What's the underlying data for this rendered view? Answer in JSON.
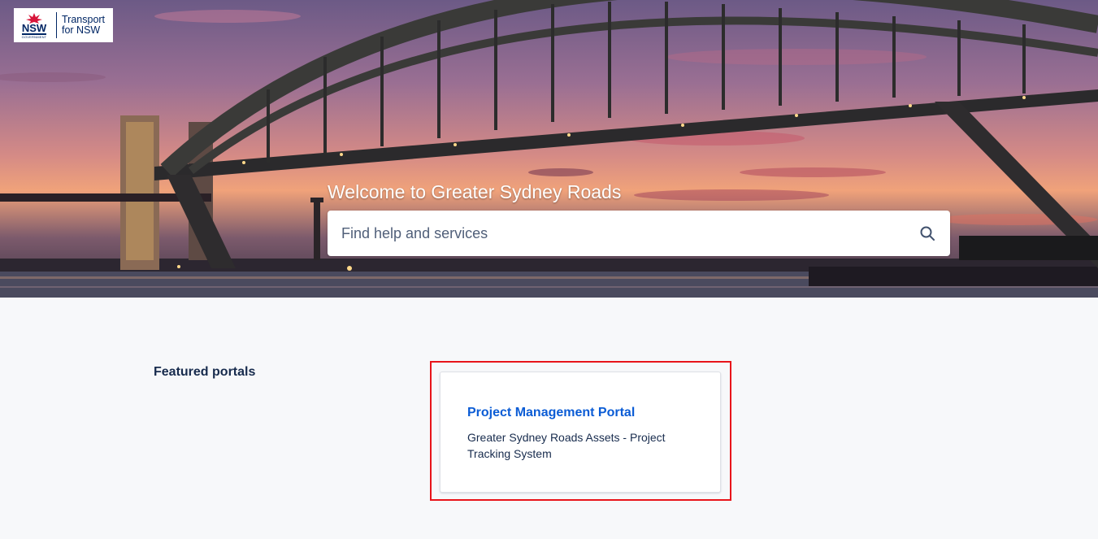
{
  "header": {
    "logo": {
      "nsw_text": "NSW",
      "gov_text": "GOVERNMENT",
      "transport_line1": "Transport",
      "transport_line2": "for NSW"
    },
    "welcome_title": "Welcome to Greater Sydney Roads"
  },
  "search": {
    "placeholder": "Find help and services",
    "icon": "search-icon"
  },
  "featured": {
    "heading": "Featured portals",
    "portals": [
      {
        "title": "Project Management Portal",
        "description": "Greater Sydney Roads Assets - Project Tracking System"
      }
    ]
  },
  "colors": {
    "brand_navy": "#002664",
    "link_blue": "#0b5cd5",
    "text_dark": "#172b4d",
    "highlight_red": "#e8141a",
    "waratah_red": "#d7153a"
  }
}
